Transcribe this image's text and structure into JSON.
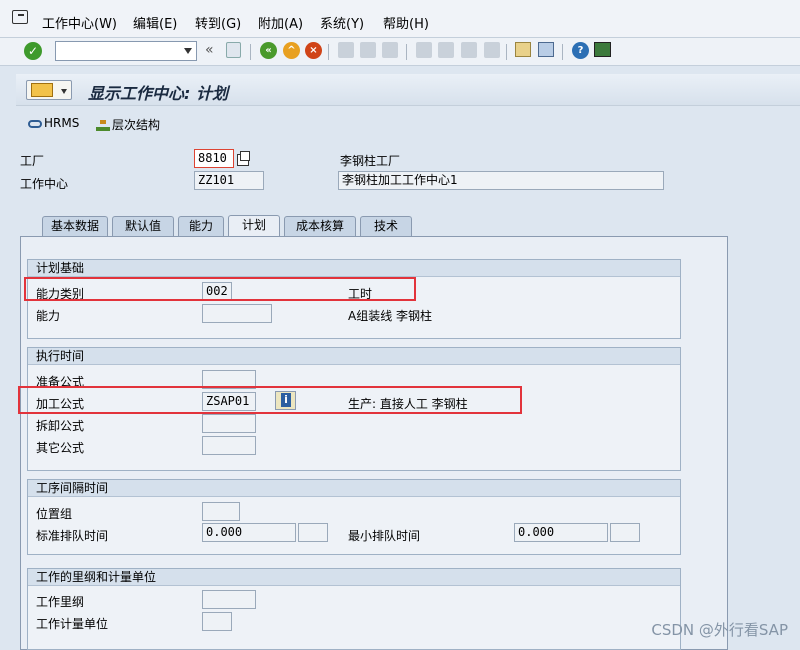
{
  "menu": {
    "items": [
      "工作中心(W)",
      "编辑(E)",
      "转到(G)",
      "附加(A)",
      "系统(Y)",
      "帮助(H)"
    ]
  },
  "toolbar": {
    "command_field_value": "",
    "icons": [
      "enter-icon",
      "command-field",
      "save-icon",
      "back-icon",
      "exit-icon",
      "cancel-icon",
      "print-icon",
      "find-icon",
      "find-next-icon",
      "first-page-icon",
      "previous-page-icon",
      "next-page-icon",
      "last-page-icon",
      "new-session-icon",
      "shortcut-icon",
      "help-icon",
      "layout-icon"
    ]
  },
  "title": {
    "text": "显示工作中心: 计划"
  },
  "app_toolbar": {
    "hrms_label": "HRMS",
    "hierarchy_label": "层次结构"
  },
  "header": {
    "plant_label": "工厂",
    "plant_value": "8810",
    "plant_desc": "李钢柱工厂",
    "workcenter_label": "工作中心",
    "workcenter_value": "ZZ101",
    "workcenter_desc": "李钢柱加工工作中心1"
  },
  "tabs": [
    {
      "label": "基本数据",
      "active": false
    },
    {
      "label": "默认值",
      "active": false
    },
    {
      "label": "能力",
      "active": false
    },
    {
      "label": "计划",
      "active": true
    },
    {
      "label": "成本核算",
      "active": false
    },
    {
      "label": "技术",
      "active": false
    }
  ],
  "groups": {
    "planning_basis": {
      "title": "计划基础",
      "capacity_category_label": "能力类别",
      "capacity_category_value": "002",
      "capacity_category_desc": "工时",
      "capacity_label": "能力",
      "capacity_value": "",
      "capacity_desc": "A组装线 李钢柱"
    },
    "execution_time": {
      "title": "执行时间",
      "setup_formula_label": "准备公式",
      "setup_formula_value": "",
      "processing_formula_label": "加工公式",
      "processing_formula_value": "ZSAP01",
      "processing_formula_desc": "生产: 直接人工 李钢柱",
      "teardown_formula_label": "拆卸公式",
      "teardown_formula_value": "",
      "other_formula_label": "其它公式",
      "other_formula_value": ""
    },
    "interoperation_time": {
      "title": "工序间隔时间",
      "location_group_label": "位置组",
      "location_group_value": "",
      "std_queue_label": "标准排队时间",
      "std_queue_value": "0.000",
      "std_queue_unit": "",
      "min_queue_label": "最小排队时间",
      "min_queue_value": "0.000",
      "min_queue_unit": ""
    },
    "work_unit": {
      "title": "工作的里纲和计量单位",
      "work_dim_label": "工作里纲",
      "work_dim_value": "",
      "work_unit_label": "工作计量单位",
      "work_unit_value": ""
    }
  },
  "watermark": "CSDN @外行看SAP",
  "colors": {
    "highlight": "#e2333b",
    "background": "#dde6f0"
  }
}
